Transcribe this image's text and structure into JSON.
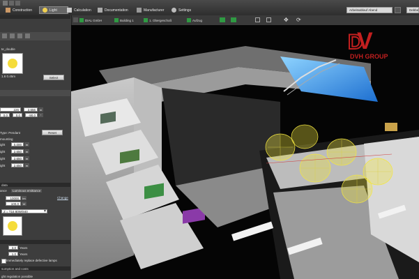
{
  "tabs": [
    {
      "label": "Construction",
      "icon": "construction-icon",
      "active": false
    },
    {
      "label": "Light",
      "icon": "light-icon",
      "active": true
    },
    {
      "label": "Calculation",
      "icon": "calculation-icon",
      "active": false
    },
    {
      "label": "Documentation",
      "icon": "documentation-icon",
      "active": false
    },
    {
      "label": "Manufacturer",
      "icon": "manufacturer-icon",
      "active": false
    },
    {
      "label": "Settings",
      "icon": "settings-icon",
      "active": false
    }
  ],
  "topbar": {
    "project_select": "Arbeitsablauf Abend",
    "right_button": "Debbe"
  },
  "breadcrumb": {
    "items": [
      "DIAL GmbH",
      "Building 1",
      "1. Obergeschoß",
      "Aufzug"
    ]
  },
  "sidebar": {
    "luminaire_name": "te_double",
    "luminaire_size": "1.6 0.45m",
    "select_button": "Select",
    "position": {
      "row1": [
        "226",
        "2.656"
      ],
      "row2": [
        "0.0",
        "0.0",
        "-90.0"
      ]
    },
    "type_label": "Type: Pendant",
    "reset_button": "Reset",
    "mounting_label": "mounting",
    "heights": [
      {
        "label": "ight",
        "value": "0.000"
      },
      {
        "label": "ight",
        "value": "2.650"
      },
      {
        "label": "ight",
        "value": "2.650"
      },
      {
        "label": "ight",
        "value": "2.650"
      }
    ],
    "unit_m": "m",
    "data_section": "data",
    "subtabs": [
      "ance",
      "Luminous emittance"
    ],
    "change_link": "Change",
    "flux": {
      "value1": "10000",
      "unit1": "lm",
      "value2": "100.0",
      "unit2": "W"
    },
    "lamp_select": "Z = T16 80W/840",
    "maintenance": {
      "years1": "3.0",
      "years2": "1.0",
      "unit": "Years"
    },
    "replace_label": "Immediately replace defective lamps",
    "consumption_label": "sumption and costs",
    "regulation_label": "ght regulation possible",
    "colors": {
      "field_bg": "#ffffff",
      "panel_bg": "#3d3d3d",
      "section_bg": "#2a2a2a",
      "accent_green": "#2f9a43"
    }
  },
  "logo": {
    "brand": "DVH GROUP"
  }
}
